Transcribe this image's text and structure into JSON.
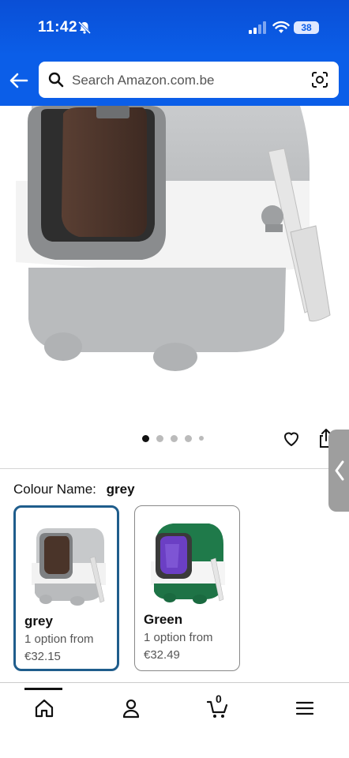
{
  "status": {
    "time": "11:42",
    "battery": "38"
  },
  "search": {
    "placeholder": "Search Amazon.com.be"
  },
  "colour": {
    "label": "Colour Name:",
    "selected": "grey",
    "options": [
      {
        "name": "grey",
        "options_text": "1 option from",
        "price": "€32.15",
        "selected": true
      },
      {
        "name": "Green",
        "options_text": "1 option from",
        "price": "€32.49",
        "selected": false
      }
    ]
  },
  "carousel": {
    "total_images": 5,
    "current_image": 1
  },
  "cart": {
    "count": "0"
  },
  "colors": {
    "brand_blue": "#0b5ee8",
    "selected_border": "#1f5d8c",
    "green_variant": "#1f7a4a"
  }
}
